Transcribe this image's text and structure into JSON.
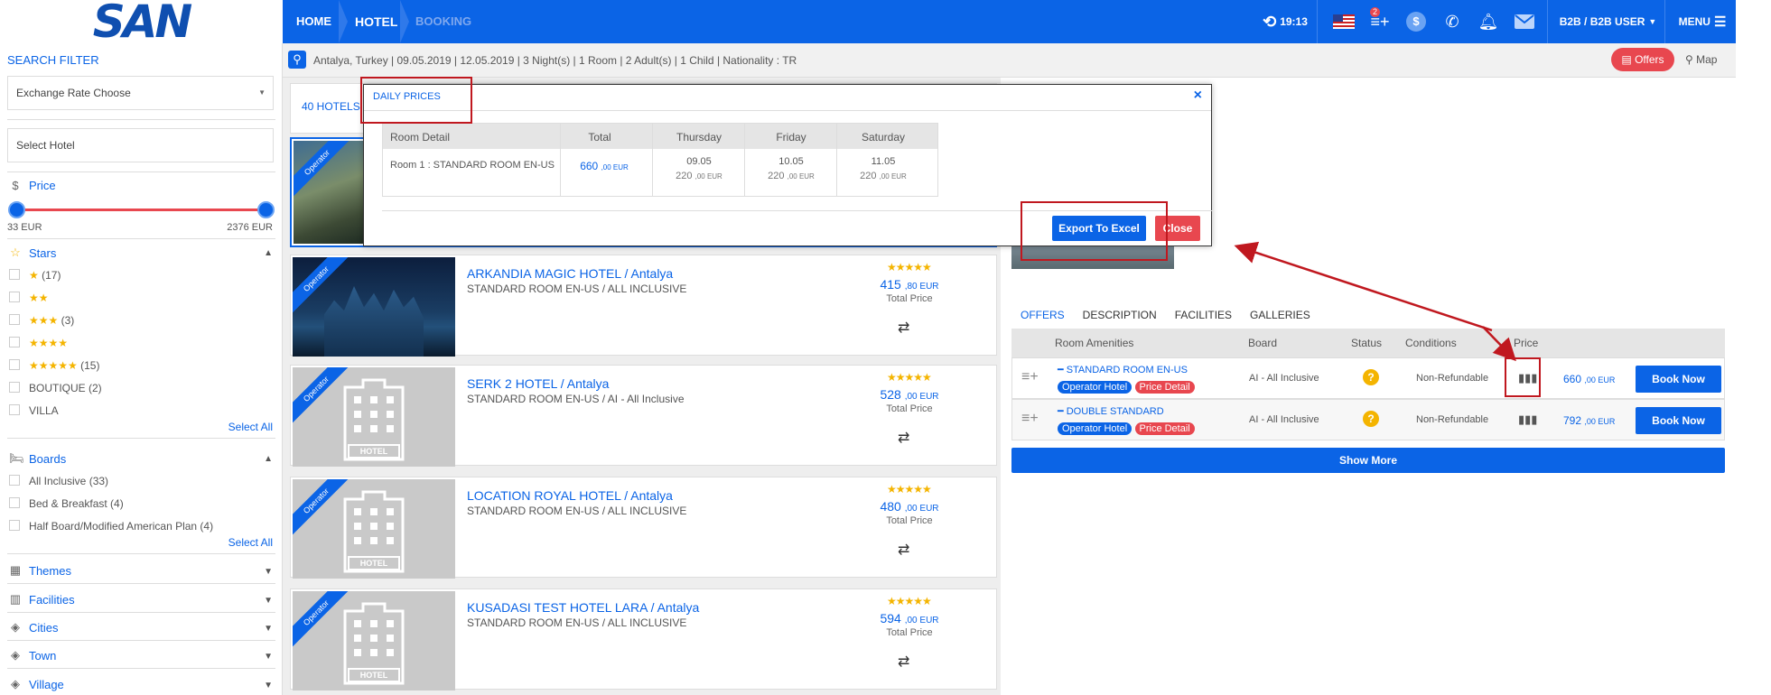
{
  "brand": {
    "logo": "SAN"
  },
  "topbar": {
    "home": "HOME",
    "hotel": "HOTEL",
    "booking": "BOOKING",
    "time": "19:13",
    "cart_count": "2",
    "user": "B2B / B2B USER",
    "menu": "MENU"
  },
  "search_summary": "Antalya, Turkey | 09.05.2019 | 12.05.2019 | 3 Night(s) | 1 Room | 2 Adult(s) | 1 Child | Nationality : TR",
  "actions": {
    "offers": "Offers",
    "map": "Map"
  },
  "sidebar": {
    "title": "SEARCH FILTER",
    "exchange_placeholder": "Exchange Rate Choose",
    "hotel_placeholder": "Select Hotel",
    "price": {
      "label": "Price",
      "min": "33 EUR",
      "max": "2376 EUR"
    },
    "stars": {
      "label": "Stars",
      "items": [
        {
          "stars": "★",
          "count": "(17)"
        },
        {
          "stars": "★★",
          "count": ""
        },
        {
          "stars": "★★★",
          "count": "(3)"
        },
        {
          "stars": "★★★★",
          "count": ""
        },
        {
          "stars": "★★★★★",
          "count": "(15)"
        },
        {
          "stars": "BOUTIQUE",
          "count": "(2)"
        },
        {
          "stars": "VILLA",
          "count": ""
        }
      ],
      "select_all": "Select All"
    },
    "boards": {
      "label": "Boards",
      "items": [
        "All Inclusive  (33)",
        "Bed & Breakfast  (4)",
        "Half Board/Modified American Plan  (4)"
      ],
      "select_all": "Select All"
    },
    "collapsed": [
      "Themes",
      "Facilities",
      "Cities",
      "Town",
      "Village"
    ]
  },
  "results": {
    "count_label": "40 HOTELS"
  },
  "hotels": [
    {
      "name": "ARKANDIA MAGIC HOTEL / Antalya",
      "room": "STANDARD ROOM EN-US / ALL INCLUSIVE",
      "stars": "★★★★★",
      "price": "415",
      "cents": ",80 EUR",
      "total": "Total Price",
      "badge": "Operator"
    },
    {
      "name": "SERK 2 HOTEL / Antalya",
      "room": "STANDARD ROOM EN-US / AI - All Inclusive",
      "stars": "★★★★★",
      "price": "528",
      "cents": ",00 EUR",
      "total": "Total Price",
      "badge": "Operator"
    },
    {
      "name": "LOCATION ROYAL HOTEL / Antalya",
      "room": "STANDARD ROOM EN-US / ALL INCLUSIVE",
      "stars": "★★★★★",
      "price": "480",
      "cents": ",00 EUR",
      "total": "Total Price",
      "badge": "Operator"
    },
    {
      "name": "KUSADASI TEST HOTEL LARA / Antalya",
      "room": "STANDARD ROOM EN-US / ALL INCLUSIVE",
      "stars": "★★★★★",
      "price": "594",
      "cents": ",00 EUR",
      "total": "Total Price",
      "badge": "Operator"
    }
  ],
  "first_card_badge": "Operator",
  "placeholder_caption": "HOTEL",
  "detail": {
    "tabs": [
      "OFFERS",
      "DESCRIPTION",
      "FACILITIES",
      "GALLERIES"
    ],
    "columns": {
      "amenities": "Room Amenities",
      "board": "Board",
      "status": "Status",
      "conditions": "Conditions",
      "price": "Price"
    },
    "rooms": [
      {
        "name": "STANDARD ROOM EN-US",
        "board": "AI - All Inclusive",
        "conditions": "Non-Refundable",
        "price": "660",
        "cents": ",00 EUR",
        "operator": "Operator Hotel",
        "price_detail": "Price Detail",
        "book": "Book Now"
      },
      {
        "name": "DOUBLE STANDARD",
        "board": "AI - All Inclusive",
        "conditions": "Non-Refundable",
        "price": "792",
        "cents": ",00 EUR",
        "operator": "Operator Hotel",
        "price_detail": "Price Detail",
        "book": "Book Now"
      }
    ],
    "show_more": "Show More"
  },
  "modal": {
    "title": "DAILY PRICES",
    "headers": [
      "Room Detail",
      "Total",
      "Thursday",
      "Friday",
      "Saturday"
    ],
    "room": "Room 1 : STANDARD ROOM EN-US",
    "total": "660",
    "total_cents": ",00 EUR",
    "days": [
      {
        "date": "09.05",
        "price": "220",
        "cents": ",00 EUR"
      },
      {
        "date": "10.05",
        "price": "220",
        "cents": ",00 EUR"
      },
      {
        "date": "11.05",
        "price": "220",
        "cents": ",00 EUR"
      }
    ],
    "export": "Export To Excel",
    "close": "Close"
  },
  "colors": {
    "primary": "#0b64e6",
    "danger": "#e8474f",
    "star": "#f4b400",
    "annotation": "#c0181f"
  }
}
